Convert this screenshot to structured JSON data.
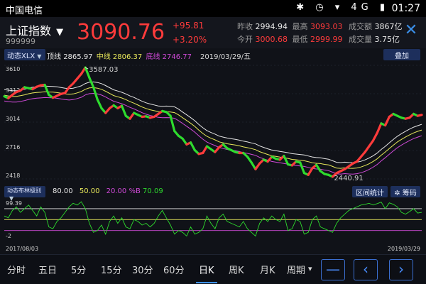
{
  "status_bar": {
    "carrier": "中国电信",
    "icons": "✱ ◷ ▾ 4G ▮",
    "time": "01:27"
  },
  "header": {
    "index_name": "上证指数",
    "dropdown_icon": "▼",
    "index_code": "999999",
    "price": "3090.76",
    "change": "+95.81",
    "change_pct": "+3.20%",
    "prev_close_label": "昨收",
    "prev_close": "2994.94",
    "high_label": "最高",
    "high": "3093.03",
    "turnover_label": "成交额",
    "turnover": "3867亿",
    "open_label": "今开",
    "open": "3000.68",
    "low_label": "最低",
    "low": "2999.99",
    "volume_label": "成交量",
    "volume": "3.75亿",
    "close_icon": "✕"
  },
  "main_indicator": {
    "selector": "动态XLX",
    "top_label": "顶线",
    "top_value": "2865.97",
    "mid_label": "中线",
    "mid_value": "2806.37",
    "bottom_label": "底线",
    "bottom_value": "2746.77",
    "date": "2019/03/29/五",
    "overlay_button": "叠加"
  },
  "sub_indicator": {
    "selector": "动态布林级别",
    "v1": "80.00",
    "v2": "50.00",
    "v3": "20.00",
    "v4_label": "%B",
    "v4": "70.09",
    "interval_button": "区间统计",
    "chips_button": "筹码"
  },
  "axis": {
    "main_ticks": [
      "3610",
      "3312",
      "3014",
      "2716",
      "2418"
    ],
    "sub_ticks": [
      "99.39",
      "-2"
    ],
    "start_date": "2017/08/03",
    "end_date": "2019/03/29",
    "peak_label": "3587.03",
    "trough_label": "2440.91"
  },
  "colors": {
    "up": "#ff3b3b",
    "down": "#2edb2e",
    "accent": "#3b8fe8"
  },
  "tabs": [
    "分时",
    "五日",
    "5分",
    "15分",
    "30分",
    "60分",
    "日K",
    "周K",
    "月K",
    "周期"
  ],
  "active_tab": "日K",
  "period_arrow": "▾",
  "nav": {
    "minus": "—",
    "prev": "‹",
    "next": "›"
  },
  "chart_data": [
    {
      "type": "line",
      "x_range": [
        "2017/08/03",
        "2019/03/29"
      ],
      "ylim": [
        2418,
        3610
      ],
      "y_ticks": [
        3610,
        3312,
        3014,
        2716,
        2418
      ],
      "series": [
        {
          "name": "K线",
          "values": [
            3285,
            3265,
            3300,
            3330,
            3345,
            3380,
            3370,
            3360,
            3385,
            3400,
            3405,
            3300,
            3270,
            3290,
            3310,
            3320,
            3380,
            3420,
            3470,
            3520,
            3587,
            3480,
            3380,
            3250,
            3160,
            3110,
            3160,
            3190,
            3160,
            3185,
            3080,
            3050,
            3110,
            3090,
            3070,
            3075,
            3060,
            3070,
            3100,
            3130,
            3120,
            3080,
            2920,
            2870,
            2840,
            2780,
            2800,
            2720,
            2680,
            2690,
            2760,
            2730,
            2700,
            2750,
            2780,
            2740,
            2720,
            2700,
            2690,
            2690,
            2650,
            2590,
            2520,
            2580,
            2620,
            2600,
            2650,
            2630,
            2620,
            2660,
            2570,
            2560,
            2600,
            2590,
            2480,
            2460,
            2530,
            2565,
            2500,
            2470,
            2460,
            2441,
            2480,
            2500,
            2520,
            2550,
            2580,
            2600,
            2650,
            2700,
            2760,
            2820,
            2900,
            3000,
            2980,
            3070,
            3100,
            3080,
            3060,
            3050,
            3060,
            3100,
            3080,
            3090
          ]
        },
        {
          "name": "顶线",
          "values": [
            3356,
            3349,
            3344,
            3344,
            3351,
            3360,
            3372,
            3380,
            3385,
            3388,
            3392,
            3390,
            3389,
            3384,
            3377,
            3370,
            3366,
            3370,
            3381,
            3395,
            3419,
            3433,
            3436,
            3430,
            3418,
            3398,
            3375,
            3353,
            3340,
            3327,
            3310,
            3289,
            3273,
            3253,
            3233,
            3217,
            3204,
            3194,
            3184,
            3180,
            3182,
            3180,
            3174,
            3150,
            3120,
            3091,
            3061,
            3029,
            2990,
            2955,
            2925,
            2905,
            2888,
            2867,
            2857,
            2847,
            2840,
            2834,
            2825,
            2814,
            2806,
            2796,
            2785,
            2764,
            2749,
            2734,
            2721,
            2714,
            2707,
            2700,
            2693,
            2683,
            2679,
            2674,
            2669,
            2659,
            2648,
            2642,
            2639,
            2631,
            2625,
            2609,
            2592,
            2589,
            2594,
            2590,
            2589,
            2593,
            2603,
            2618,
            2637,
            2661,
            2689,
            2727,
            2760,
            2797,
            2832,
            2866,
            2893,
            2918,
            2941,
            2961,
            2977,
            2991
          ]
        },
        {
          "name": "中线",
          "values": [
            3296,
            3289,
            3284,
            3284,
            3291,
            3300,
            3312,
            3320,
            3325,
            3328,
            3332,
            3330,
            3329,
            3324,
            3317,
            3310,
            3306,
            3310,
            3321,
            3335,
            3359,
            3373,
            3376,
            3370,
            3358,
            3338,
            3315,
            3293,
            3280,
            3267,
            3250,
            3229,
            3213,
            3193,
            3173,
            3157,
            3144,
            3134,
            3124,
            3120,
            3122,
            3120,
            3114,
            3090,
            3060,
            3031,
            3001,
            2969,
            2930,
            2895,
            2865,
            2845,
            2828,
            2807,
            2797,
            2787,
            2780,
            2774,
            2765,
            2754,
            2746,
            2736,
            2725,
            2704,
            2689,
            2674,
            2661,
            2654,
            2647,
            2640,
            2633,
            2623,
            2619,
            2614,
            2609,
            2599,
            2588,
            2582,
            2579,
            2571,
            2565,
            2549,
            2532,
            2529,
            2534,
            2530,
            2529,
            2533,
            2543,
            2558,
            2577,
            2601,
            2629,
            2667,
            2700,
            2737,
            2772,
            2806,
            2833,
            2858,
            2881,
            2901,
            2917,
            2931
          ]
        },
        {
          "name": "底线",
          "values": [
            3236,
            3229,
            3224,
            3224,
            3231,
            3240,
            3252,
            3260,
            3265,
            3268,
            3272,
            3270,
            3269,
            3264,
            3257,
            3250,
            3246,
            3250,
            3261,
            3275,
            3299,
            3313,
            3316,
            3310,
            3298,
            3278,
            3255,
            3233,
            3220,
            3207,
            3190,
            3169,
            3153,
            3133,
            3113,
            3097,
            3084,
            3074,
            3064,
            3060,
            3062,
            3060,
            3054,
            3030,
            3000,
            2971,
            2941,
            2909,
            2870,
            2835,
            2805,
            2785,
            2768,
            2747,
            2737,
            2727,
            2720,
            2714,
            2705,
            2694,
            2686,
            2676,
            2665,
            2644,
            2629,
            2614,
            2601,
            2594,
            2587,
            2580,
            2573,
            2563,
            2559,
            2554,
            2549,
            2539,
            2528,
            2522,
            2519,
            2511,
            2505,
            2489,
            2472,
            2469,
            2474,
            2470,
            2469,
            2473,
            2483,
            2498,
            2517,
            2541,
            2569,
            2607,
            2640,
            2677,
            2712,
            2746,
            2773,
            2798,
            2821,
            2841,
            2857,
            2871
          ]
        }
      ]
    },
    {
      "type": "line",
      "x_range": [
        "2017/08/03",
        "2019/03/29"
      ],
      "ylim": [
        -2,
        99.39
      ],
      "y_ticks": [
        99.39,
        -2
      ],
      "reference_lines": [
        80,
        50,
        20
      ],
      "series": [
        {
          "name": "%B",
          "values": [
            60,
            55,
            75,
            85,
            70,
            80,
            90,
            75,
            60,
            85,
            70,
            30,
            25,
            45,
            55,
            70,
            85,
            95,
            90,
            99,
            80,
            40,
            15,
            20,
            35,
            10,
            45,
            60,
            40,
            55,
            30,
            25,
            50,
            45,
            35,
            40,
            30,
            40,
            60,
            75,
            55,
            35,
            10,
            20,
            15,
            5,
            30,
            10,
            15,
            25,
            60,
            40,
            25,
            55,
            65,
            45,
            40,
            35,
            30,
            45,
            25,
            15,
            5,
            40,
            55,
            45,
            60,
            50,
            45,
            65,
            20,
            25,
            50,
            45,
            10,
            15,
            50,
            60,
            30,
            25,
            20,
            15,
            40,
            55,
            65,
            75,
            80,
            85,
            90,
            92,
            95,
            90,
            94,
            98,
            80,
            96,
            92,
            85,
            70,
            65,
            72,
            80,
            68,
            70
          ]
        }
      ]
    }
  ]
}
